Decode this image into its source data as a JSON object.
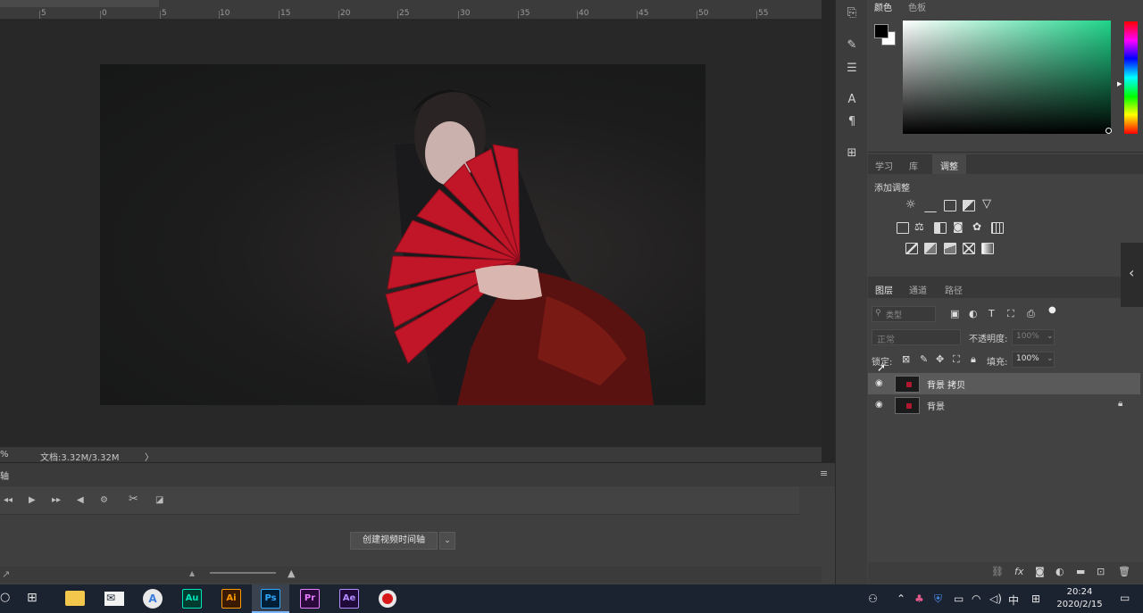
{
  "ruler": {
    "ticks": [
      "5",
      "0",
      "5",
      "10",
      "15",
      "20",
      "25",
      "30",
      "35",
      "40",
      "45",
      "50",
      "55"
    ]
  },
  "statusbar": {
    "zoom_fragment": "%",
    "doc_info": "文档:3.32M/3.32M",
    "arrow": "〉"
  },
  "color_panel": {
    "tabs": [
      "颜色",
      "色板"
    ],
    "active_tab": "颜色",
    "foreground": "#000000",
    "background": "#ffffff"
  },
  "adjust_panel": {
    "tabs": [
      "学习",
      "库",
      "调整"
    ],
    "active_tab": "调整",
    "title": "添加调整"
  },
  "layers_panel": {
    "tabs": [
      "图层",
      "通道",
      "路径"
    ],
    "active_tab": "图层",
    "search_placeholder": "类型",
    "blend_mode": "正常",
    "opacity_label": "不透明度:",
    "opacity_value": "100%",
    "lock_label": "锁定:",
    "fill_label": "填充:",
    "fill_value": "100%",
    "layers": [
      {
        "name": "背景 拷贝",
        "selected": true,
        "locked": false
      },
      {
        "name": "背景",
        "selected": false,
        "locked": true
      }
    ],
    "footer_icons": [
      "link-icon",
      "fx-icon",
      "mask-icon",
      "adjustment-icon",
      "folder-icon",
      "new-layer-icon",
      "trash-icon"
    ],
    "fx_label": "fx"
  },
  "timeline": {
    "header_fragment": "轴",
    "create_button": "创建视频时间轴"
  },
  "taskbar": {
    "apps": [
      {
        "name": "Au",
        "color": "#00e4bb",
        "bg": "#003b2f"
      },
      {
        "name": "Ai",
        "color": "#ff9a00",
        "bg": "#3a1a00"
      },
      {
        "name": "Ps",
        "color": "#31a8ff",
        "bg": "#001e36"
      },
      {
        "name": "Pr",
        "color": "#e67cff",
        "bg": "#2a0a3a"
      },
      {
        "name": "Ae",
        "color": "#b38bff",
        "bg": "#1f0a3a"
      }
    ],
    "ime": "中",
    "time": "20:24",
    "date": "2020/2/15"
  },
  "accent": "#b3172f"
}
